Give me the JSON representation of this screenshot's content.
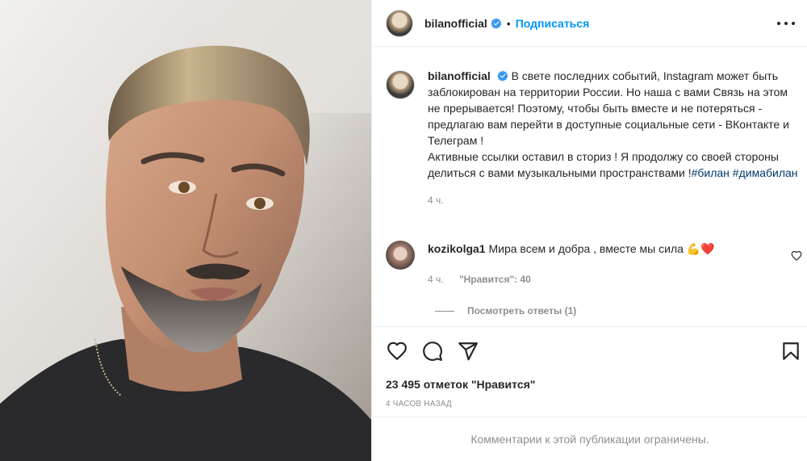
{
  "post": {
    "image_alt": "selfie",
    "author": {
      "username": "bilanofficial",
      "follow_label": "Подписаться",
      "dot": "•"
    },
    "caption": {
      "text": "В свете последних событий, Instagram может быть заблокирован на территории России. Но наша с вами Связь на этом не прерывается! Поэтому, чтобы быть вместе и не потеряться - предлагаю вам перейти в доступные социальные сети - ВКонтакте и Телеграм !",
      "text2": "Активные ссылки оставил в сториз ! Я продолжу со своей стороны делиться с вами музыкальными пространствами !",
      "hashtag1": "#билан",
      "hashtag2": "#димабилан",
      "time": "4 ч."
    },
    "comment": {
      "username": "kozikolga1",
      "text": "Мира всем и добра , вместе мы сила",
      "emoji": "💪❤️",
      "time": "4 ч.",
      "likes": "\"Нравится\": 40",
      "view_replies": "Посмотреть ответы (1)"
    },
    "likes": "23 495 отметок \"Нравится\"",
    "timestamp": "4 ЧАСОВ НАЗАД",
    "comments_disabled": "Комментарии к этой публикации ограничены."
  },
  "icons": {
    "like": "heart-icon",
    "comment": "comment-icon",
    "share": "paper-plane-icon",
    "save": "bookmark-icon",
    "more": "more-horizontal-icon",
    "verified": "verified-badge-icon"
  },
  "colors": {
    "accent": "#0095f6",
    "verified": "#3897f0",
    "hashtag": "#00376b",
    "muted": "#8e8e8e",
    "heart_emoji": "#ed4956"
  }
}
